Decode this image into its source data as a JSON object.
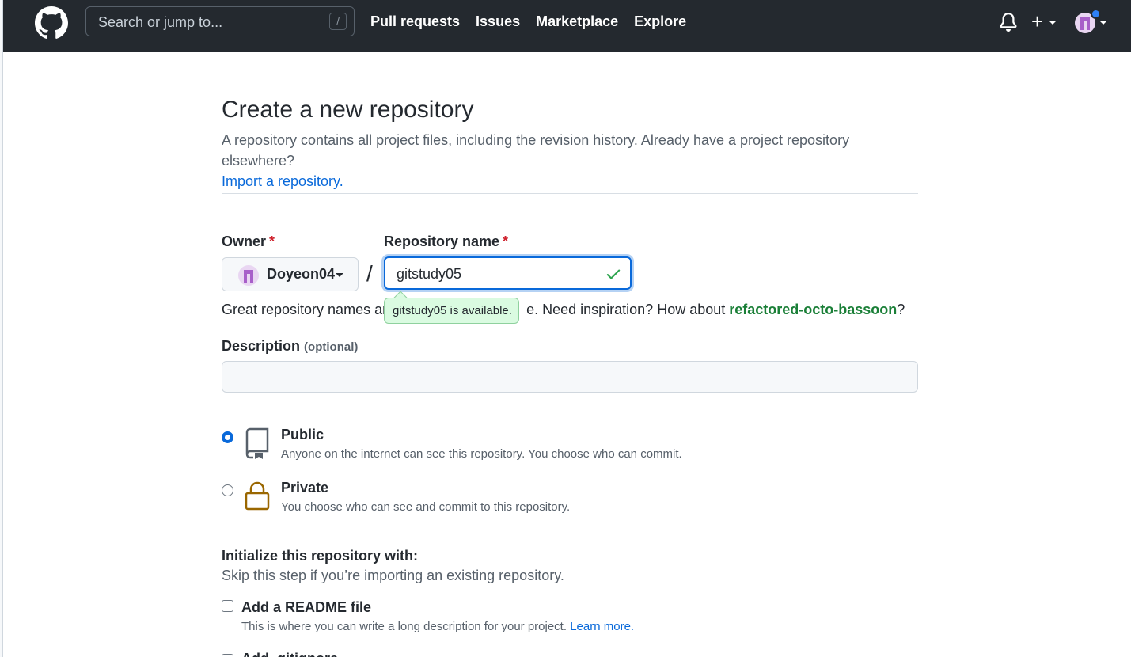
{
  "header": {
    "search_placeholder": "Search or jump to...",
    "search_shortcut": "/",
    "nav": [
      "Pull requests",
      "Issues",
      "Marketplace",
      "Explore"
    ],
    "plus_label": "+"
  },
  "page": {
    "title": "Create a new repository",
    "subtitle": "A repository contains all project files, including the revision history. Already have a project repository elsewhere?",
    "import_link": "Import a repository."
  },
  "form": {
    "owner_label": "Owner",
    "required_mark": "*",
    "owner_value": "Doyeon04",
    "separator": "/",
    "repo_label": "Repository name",
    "repo_value": "gitstudy05",
    "tooltip": "gitstudy05 is available.",
    "hint_prefix": "Great repository names are",
    "hint_middle": "e. Need inspiration? How about",
    "hint_suggestion": "refactored-octo-bassoon",
    "hint_suffix": "?",
    "description_label": "Description",
    "description_optional": "(optional)",
    "description_value": ""
  },
  "visibility": [
    {
      "title": "Public",
      "desc": "Anyone on the internet can see this repository. You choose who can commit.",
      "checked": true
    },
    {
      "title": "Private",
      "desc": "You choose who can see and commit to this repository.",
      "checked": false
    }
  ],
  "init": {
    "title": "Initialize this repository with:",
    "subtitle": "Skip this step if you’re importing an existing repository.",
    "readme_title": "Add a README file",
    "readme_desc": "This is where you can write a long description for your project.",
    "learn_more": "Learn more.",
    "next_item_partial": "Add .gitignore"
  },
  "colors": {
    "header_bg": "#24292f",
    "accent": "#0969da",
    "success": "#1a7f37",
    "private_icon": "#9a6700"
  }
}
